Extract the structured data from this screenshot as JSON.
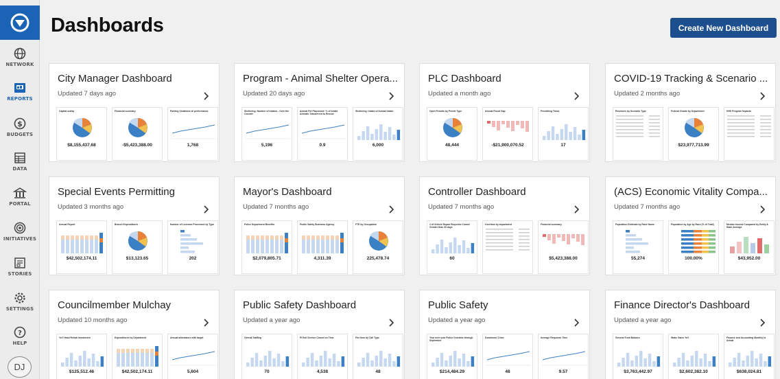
{
  "header": {
    "title": "Dashboards",
    "create_label": "Create New Dashboard"
  },
  "nav": [
    {
      "label": "NETWORK",
      "icon": "globe-icon"
    },
    {
      "label": "REPORTS",
      "icon": "reports-icon"
    },
    {
      "label": "BUDGETS",
      "icon": "dollar-icon"
    },
    {
      "label": "DATA",
      "icon": "data-table-icon"
    },
    {
      "label": "PORTAL",
      "icon": "building-icon"
    },
    {
      "label": "INITIATIVES",
      "icon": "target-icon"
    },
    {
      "label": "STORIES",
      "icon": "stories-icon"
    },
    {
      "label": "SETTINGS",
      "icon": "gear-icon"
    },
    {
      "label": "HELP",
      "icon": "help-icon"
    }
  ],
  "user": {
    "initials": "DJ"
  },
  "colors": {
    "brand": "#1b64b5",
    "button": "#1d4f8f",
    "chart_blue": "#3b7fc4",
    "chart_light": "#c5d8ef",
    "chart_orange": "#e8823a",
    "chart_red": "#e06b6b"
  },
  "cards": [
    {
      "title": "City Manager Dashboard",
      "updated": "Updated 7 days ago",
      "tiles": [
        {
          "title": "Capital outlay",
          "value": "$8,155,437.68",
          "kind": "pie"
        },
        {
          "title": "Financial summary",
          "value": "-$5,423,388.00",
          "kind": "pie"
        },
        {
          "title": "Parking Violations w/ performance",
          "value": "1,768",
          "kind": "line"
        }
      ]
    },
    {
      "title": "Program - Animal Shelter Opera...",
      "updated": "Updated 20 days ago",
      "tiles": [
        {
          "title": "Sheltering: Number of Intakes - Over the Counter",
          "value": "5,196",
          "kind": "line"
        },
        {
          "title": "Animal Pet Placement: % of Intake Animals Transferred to Rescue",
          "value": "0.9",
          "kind": "line"
        },
        {
          "title": "Sheltering: Intake of Animal Intake",
          "value": "6,000",
          "kind": "bars"
        }
      ]
    },
    {
      "title": "PLC Dashboard",
      "updated": "Updated a month ago",
      "tiles": [
        {
          "title": "Open Permits by Permit Type",
          "value": "48,444",
          "kind": "pie"
        },
        {
          "title": "Annual Fiscal Gap",
          "value": "-$21,900,070.52",
          "kind": "redbars"
        },
        {
          "title": "Permitting Times",
          "value": "17",
          "kind": "bars"
        }
      ]
    },
    {
      "title": "COVID-19 Tracking & Scenario ...",
      "updated": "Updated 2 months ago",
      "tiles": [
        {
          "title": "Revenues by Scenario Type",
          "value": "",
          "kind": "table"
        },
        {
          "title": "Federal Grants by Department",
          "value": "$23,977,713.99",
          "kind": "pie"
        },
        {
          "title": "HHS Program Impacts",
          "value": "",
          "kind": "table"
        }
      ]
    },
    {
      "title": "Special Events Permitting",
      "updated": "Updated 3 months ago",
      "tiles": [
        {
          "title": "Annual Report",
          "value": "$42,502,174.11",
          "kind": "stacked"
        },
        {
          "title": "Branch Expenditures",
          "value": "$13,123.65",
          "kind": "pie"
        },
        {
          "title": "Number of Licenses Processed by Type",
          "value": "202",
          "kind": "hbars"
        }
      ]
    },
    {
      "title": "Mayor's Dashboard",
      "updated": "Updated 7 months ago",
      "tiles": [
        {
          "title": "Police Department Benefits",
          "value": "$2,079,805.71",
          "kind": "stacked"
        },
        {
          "title": "Public Safety Business Agency",
          "value": "4,311.39",
          "kind": "stacked"
        },
        {
          "title": "FTE by Occupation",
          "value": "225,478.74",
          "kind": "pie"
        }
      ]
    },
    {
      "title": "Controller Dashboard",
      "updated": "Updated 7 months ago",
      "tiles": [
        {
          "title": "# of Vehicle Repair Requests Closed Greater than 30 days",
          "value": "60",
          "kind": "bars"
        },
        {
          "title": "Overtime by department",
          "value": "",
          "kind": "table"
        },
        {
          "title": "Financial summary",
          "value": "$5,423,388.00",
          "kind": "redbars"
        }
      ]
    },
    {
      "title": "(ACS) Economic Vitality Compa...",
      "updated": "Updated 7 months ago",
      "tiles": [
        {
          "title": "Population Estimate by Race Name",
          "value": "55,274",
          "kind": "hbars"
        },
        {
          "title": "Population by Age by Race (% of Total)",
          "value": "100.00%",
          "kind": "stackedh"
        },
        {
          "title": "Median Income Compared by Entity & State Average",
          "value": "$43,952.00",
          "kind": "colorbars"
        }
      ]
    },
    {
      "title": "Councilmember Mulchay",
      "updated": "Updated 10 months ago",
      "tiles": [
        {
          "title": "YoY Head Rehab Investment",
          "value": "$125,512.46",
          "kind": "bars"
        },
        {
          "title": "Expenditures by Department",
          "value": "$42,502,174.11",
          "kind": "stacked"
        },
        {
          "title": "Annual attendance with target",
          "value": "5,604",
          "kind": "line"
        }
      ]
    },
    {
      "title": "Public Safety Dashboard",
      "updated": "Updated a year ago",
      "tiles": [
        {
          "title": "Overall Staffing",
          "value": "70",
          "kind": "bars"
        },
        {
          "title": "PI Exit Service Closed on Time",
          "value": "4,538",
          "kind": "bars"
        },
        {
          "title": "Fire Item by Call Type",
          "value": "48",
          "kind": "bars"
        }
      ]
    },
    {
      "title": "Public Safety",
      "updated": "Updated a year ago",
      "tiles": [
        {
          "title": "Year over year Police Overtime through September",
          "value": "$214,484.29",
          "kind": "bars"
        },
        {
          "title": "Downtown Crime",
          "value": "48",
          "kind": "line"
        },
        {
          "title": "Average Response Time",
          "value": "9.57",
          "kind": "line"
        }
      ]
    },
    {
      "title": "Finance Director's Dashboard",
      "updated": "Updated a year ago",
      "tiles": [
        {
          "title": "General Fund Balance",
          "value": "$3,763,442.97",
          "kind": "bars"
        },
        {
          "title": "Water Sales YoY",
          "value": "$2,602,382.10",
          "kind": "bars"
        },
        {
          "title": "Finance and Accounting Monthly to Actual",
          "value": "$638,024.81",
          "kind": "bars"
        }
      ]
    }
  ]
}
